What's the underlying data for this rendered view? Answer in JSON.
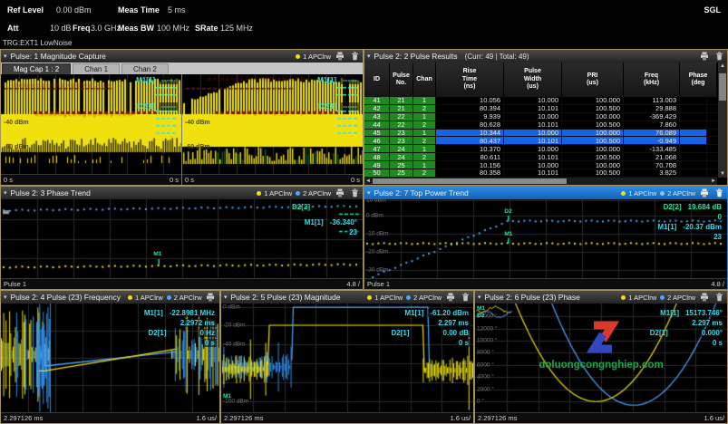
{
  "header": {
    "ref_level_label": "Ref Level",
    "ref_level": "0.00 dBm",
    "meas_time_label": "Meas Time",
    "meas_time": "5 ms",
    "att_label": "Att",
    "att": "10 dB",
    "freq_label": "Freq",
    "freq": "3.0 GHz",
    "meas_bw_label": "Meas BW",
    "meas_bw": "100 MHz",
    "srate_label": "SRate",
    "srate": "125 MHz",
    "trigger": "TRG:EXT1  LowNoise",
    "mode": "SGL"
  },
  "legend": {
    "t1": "1 APClrw",
    "t2": "2 APClrw"
  },
  "trace_colors": {
    "trace1": "#f0e10c",
    "trace2": "#4da6ff"
  },
  "watermark": {
    "text": "doluongcongnghiep.com",
    "red": "#d93a2b",
    "blue": "#3348c0"
  },
  "windows": {
    "cap": {
      "title": "Pulse: 1 Magnitude Capture",
      "tabs": [
        "Mag Cap 1 : 2",
        "Chan 1",
        "Chan 2"
      ],
      "panels": [
        {
          "m1_label": "M1[1]",
          "m1_value": "------",
          "d2_label": "D2[1]",
          "d2_value": "------",
          "y_labels": [
            "-40 dBm",
            "-60 dBm"
          ],
          "x_left": "0 s",
          "x_right": "0 s"
        },
        {
          "m1_label": "M1[1]",
          "m1_value": "------",
          "d2_label": "D2[1]",
          "d2_value": "------",
          "y_labels": [
            "-40 dBm",
            "-60 dBm"
          ],
          "x_left": "0 s",
          "x_right": "0 s"
        }
      ]
    },
    "results": {
      "title": "Pulse 2: 2 Pulse Results",
      "counter": "(Curr: 49 | Total: 49)",
      "columns": [
        "ID",
        "Pulse\nNo.",
        "Chan",
        "Rise\nTime\n(ns)",
        "Pulse\nWidth\n(us)",
        "PRI\n(us)",
        "Freq\n(kHz)",
        "Phase\n(deg"
      ],
      "rows": [
        [
          "41",
          "21",
          "1",
          "10.056",
          "10.000",
          "100.000",
          "113.003",
          ""
        ],
        [
          "42",
          "21",
          "2",
          "80.394",
          "10.101",
          "100.500",
          "29.888",
          ""
        ],
        [
          "43",
          "22",
          "1",
          "9.939",
          "10.000",
          "100.000",
          "-369.429",
          ""
        ],
        [
          "44",
          "22",
          "2",
          "80.628",
          "10.101",
          "100.500",
          "7.860",
          ""
        ],
        [
          "45",
          "23",
          "1",
          "10.344",
          "10.000",
          "100.000",
          "76.089",
          ""
        ],
        [
          "46",
          "23",
          "2",
          "80.437",
          "10.101",
          "100.500",
          "-0.949",
          ""
        ],
        [
          "47",
          "24",
          "1",
          "10.370",
          "10.000",
          "100.000",
          "-133.485",
          ""
        ],
        [
          "48",
          "24",
          "2",
          "80.611",
          "10.101",
          "100.500",
          "21.068",
          ""
        ],
        [
          "49",
          "25",
          "1",
          "10.156",
          "10.000",
          "100.000",
          "70.708",
          ""
        ],
        [
          "50",
          "25",
          "2",
          "80.358",
          "10.101",
          "100.500",
          "3.825",
          ""
        ]
      ],
      "selected_ids": [
        "45",
        "46"
      ]
    },
    "phaseTrend": {
      "title": "Pulse 2: 3 Phase Trend",
      "d2_label": "D2[2]",
      "m1_label": "M1[1]",
      "m1_value": "-36.340°",
      "m1_value2": "23",
      "m1_tick": "M1",
      "x_left": "Pulse 1",
      "x_right": "4.8 /"
    },
    "powerTrend": {
      "title": "Pulse 2: 7 Top Power Trend",
      "d2_label": "D2[2]",
      "d2_value": "19.684 dB",
      "d2_value2": "0",
      "m1_label": "M1[1]",
      "m1_value": "-20.37 dBm",
      "m1_value2": "23",
      "m1_tick": "M1",
      "d2_tick": "D2",
      "y_labels": [
        {
          "t": "10 dBm",
          "f": 0.01
        },
        {
          "t": "0 dBm",
          "f": 0.212
        },
        {
          "t": "-10 dBm",
          "f": 0.437
        },
        {
          "t": "-20 dBm",
          "f": 0.667
        },
        {
          "t": "-30 dBm",
          "f": 0.897
        }
      ],
      "x_left": "Pulse 1",
      "x_right": "4.8 /"
    },
    "freq": {
      "title": "Pulse 2: 4 Pulse (23) Frequency",
      "m1_label": "M1[1]",
      "m1_value": "-22.8981 MHz",
      "m1_value2": "2.2972 ms",
      "d2_label": "D2[1]",
      "d2_value": "0 Hz",
      "d2_value2": "0 s",
      "x_left": "2.297126 ms",
      "x_right": "1.6 us/"
    },
    "mag": {
      "title": "Pulse 2: 5 Pulse (23) Magnitude",
      "m1_label": "M1[1]",
      "m1_value": "-61.20 dBm",
      "m1_value2": "2.297 ms",
      "d2_label": "D2[1]",
      "d2_value": "0.00 dB",
      "d2_value2": "0 s",
      "m1_tick": "M1",
      "y_labels": [
        {
          "t": "0 dBm",
          "f": 0.035
        },
        {
          "t": "-20 dBm",
          "f": 0.2
        },
        {
          "t": "-40 dBm",
          "f": 0.375
        },
        {
          "t": "-100 dBm",
          "f": 0.9
        }
      ],
      "x_left": "2.297126 ms",
      "x_right": "1.6 us/"
    },
    "phase": {
      "title": "Pulse 2: 6 Pulse (23) Phase",
      "m1_label": "M1[1]",
      "m1_value": "15173.746°",
      "m1_value2": "2.297 ms",
      "d2_label": "D2[1]",
      "d2_value": "0.000°",
      "d2_value2": "0 s",
      "m1_tick": "M1",
      "d2_tick": "D2",
      "y_labels": [
        {
          "t": "14000 °",
          "f": 0.118
        },
        {
          "t": "12000 °",
          "f": 0.23
        },
        {
          "t": "10000 °",
          "f": 0.342
        },
        {
          "t": "8000 °",
          "f": 0.454
        },
        {
          "t": "6000 °",
          "f": 0.566
        },
        {
          "t": "4000 °",
          "f": 0.678
        },
        {
          "t": "2000 °",
          "f": 0.79
        },
        {
          "t": "0 °",
          "f": 0.902
        }
      ],
      "x_left": "2.297126 ms",
      "x_right": "1.6 us/"
    }
  },
  "chart_specs": {
    "colors": {
      "yellow": "#f0e10c",
      "blue": "#4da6ff",
      "grid": "#2b2b2b",
      "cyan": "#38dcea",
      "green": "#1ce8a2",
      "red": "#7e150a",
      "gray": "#8a8a8a",
      "darkgreen": "#135c13"
    },
    "cap0": {
      "variant": 0,
      "seed": 7
    },
    "cap1": {
      "variant": 1,
      "seed": 13
    },
    "w3": {
      "blue": [
        0.13,
        0.075
      ],
      "yellow": [
        0.85,
        0.815
      ],
      "m1x": 0.435,
      "n": 58
    },
    "w4": {
      "grid_y": [
        0.01,
        0.212,
        0.437,
        0.667,
        0.897
      ],
      "plateau": 0.264,
      "rise_end": 0.4,
      "start": 1.0,
      "yellow": 0.55,
      "mx": 0.395,
      "n": 64
    },
    "w5": {
      "noise": [
        [
          0,
          0.225
        ],
        [
          0.78,
          1
        ]
      ],
      "yellow_ramp": [
        0.2,
        0.62,
        0.8,
        0.42
      ],
      "blue_ramp": [
        0.2,
        0.575,
        0.8,
        0.445
      ],
      "seed": 21
    },
    "w6": {
      "grid_y": [
        0.035,
        0.2,
        0.375,
        0.55,
        0.725,
        0.9
      ],
      "yellow_pulse": [
        0.185,
        0.8,
        0.2
      ],
      "blue_pulse": [
        0.28,
        0.82,
        0.035
      ],
      "noise_y": 0.585,
      "seed": 33
    },
    "w7": {
      "grid_y": [
        0.118,
        0.23,
        0.342,
        0.454,
        0.566,
        0.678,
        0.79,
        0.902
      ],
      "k": 158000,
      "yellow_vertex": [
        0.48,
        0
      ],
      "blue_vertex": [
        0.63,
        -600
      ],
      "deg_to_frac": 5.6e-05,
      "base": 0.902,
      "seed": 44
    }
  }
}
